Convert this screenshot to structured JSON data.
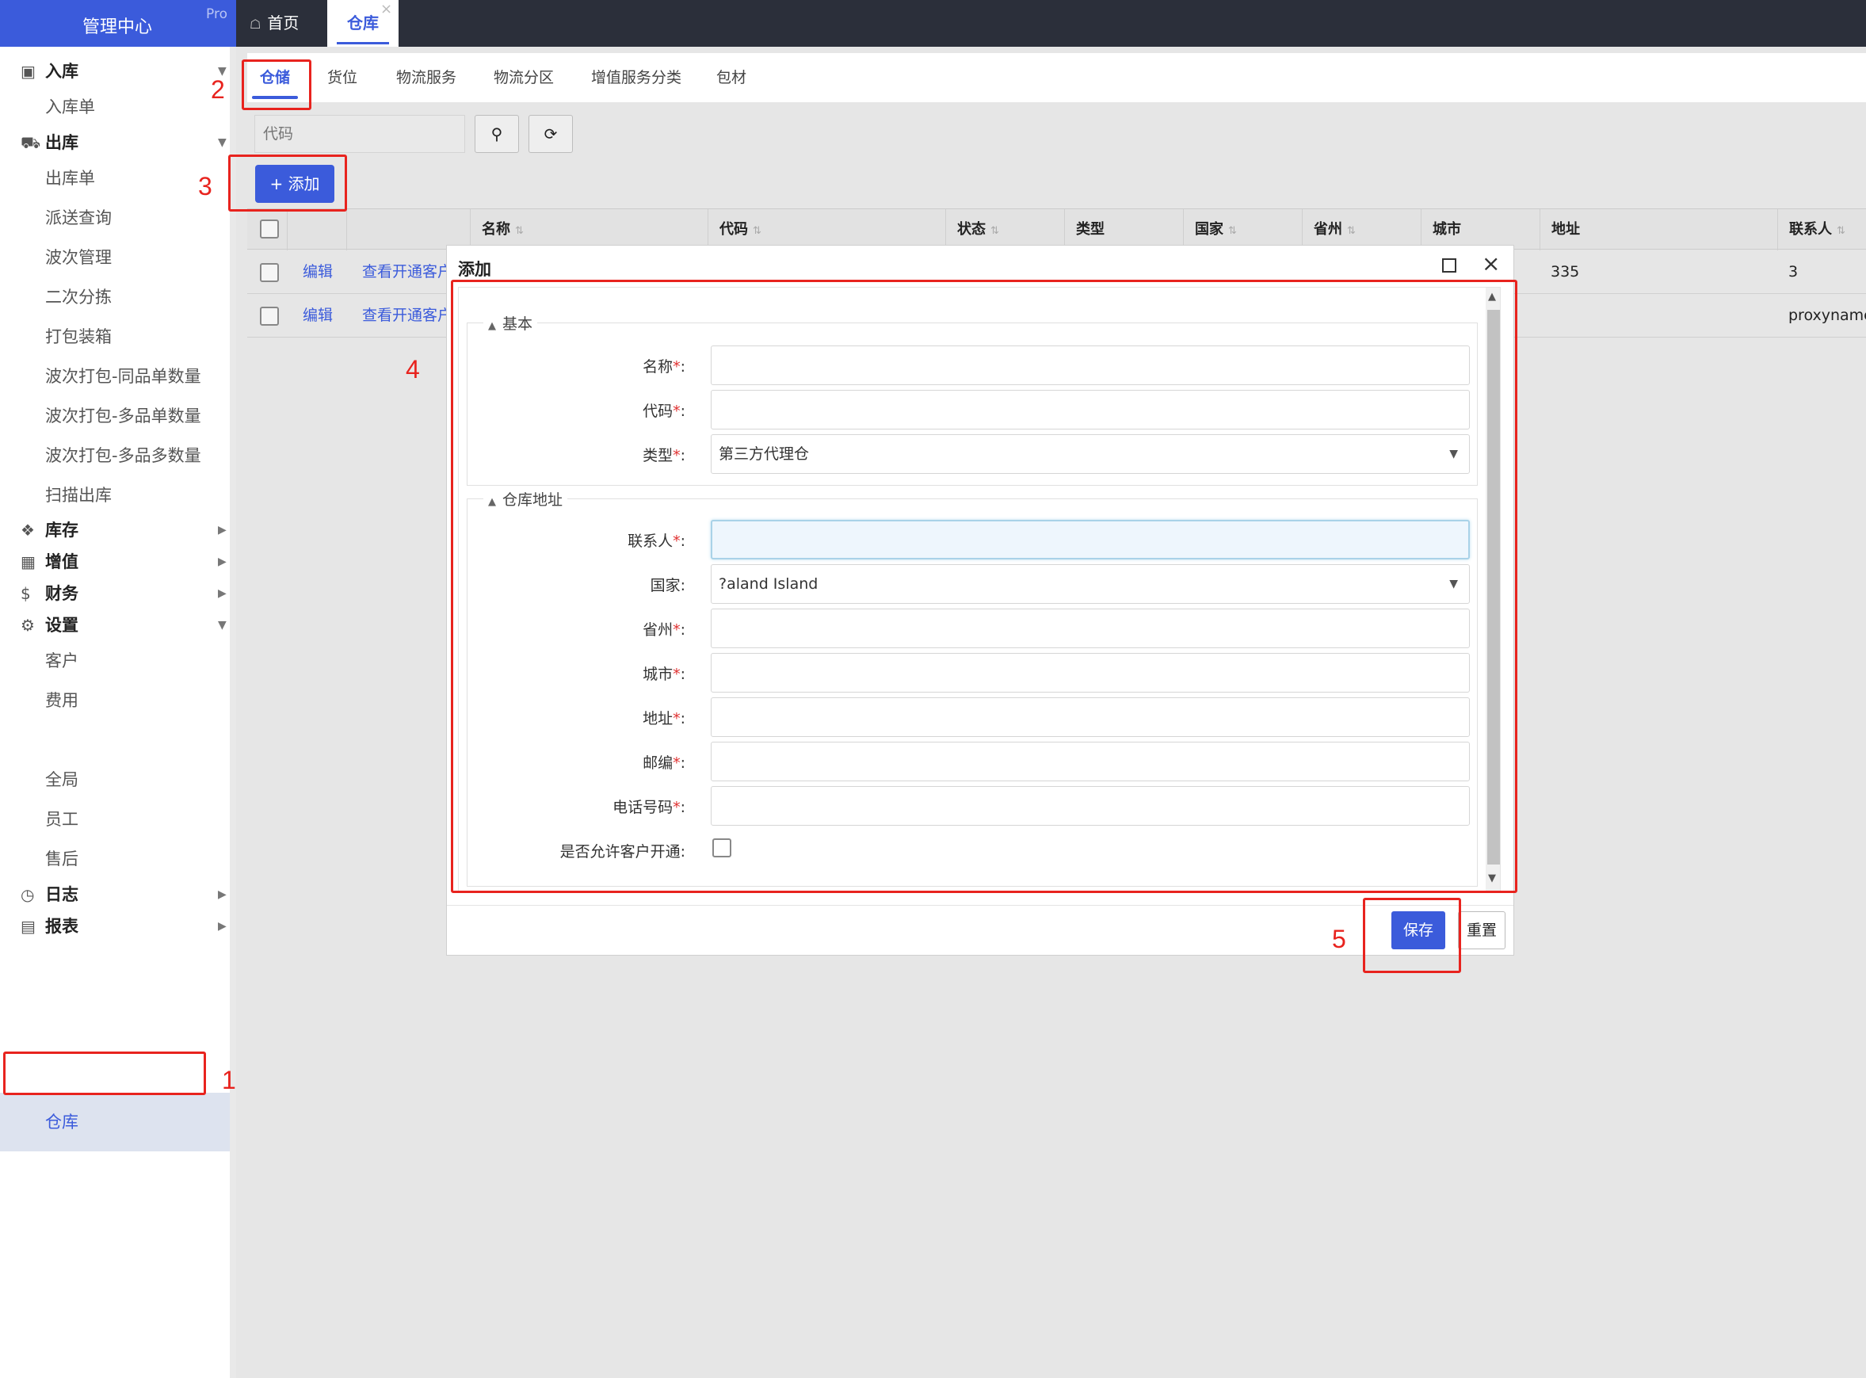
{
  "header": {
    "brand": "管理中心",
    "brand_badge": "Pro",
    "tabs": [
      {
        "label": "首页",
        "icon": "home-icon"
      },
      {
        "label": "仓库",
        "icon": "",
        "active": true
      }
    ],
    "close_glyph": "×"
  },
  "sidebar": {
    "groups": [
      {
        "label": "入库",
        "icon": "inbox-icon",
        "expanded": true,
        "items": [
          "入库单"
        ]
      },
      {
        "label": "出库",
        "icon": "truck-icon",
        "expanded": true,
        "items": [
          "出库单",
          "派送查询",
          "波次管理",
          "二次分拣",
          "打包装箱",
          "波次打包-同品单数量",
          "波次打包-多品单数量",
          "波次打包-多品多数量",
          "扫描出库"
        ]
      },
      {
        "label": "库存",
        "icon": "cubes-icon",
        "expanded": false
      },
      {
        "label": "增值",
        "icon": "grid-icon",
        "expanded": false
      },
      {
        "label": "财务",
        "icon": "dollar-icon",
        "expanded": false
      },
      {
        "label": "设置",
        "icon": "gears-icon",
        "expanded": true,
        "items": [
          "客户",
          "费用",
          "仓库",
          "全局",
          "员工",
          "售后"
        ],
        "selected": "仓库"
      },
      {
        "label": "日志",
        "icon": "clock-icon",
        "expanded": false
      },
      {
        "label": "报表",
        "icon": "bar-chart-icon",
        "expanded": false
      }
    ]
  },
  "subtabs": [
    "仓储",
    "货位",
    "物流服务",
    "物流分区",
    "增值服务分类",
    "包材"
  ],
  "toolbar": {
    "search_placeholder": "代码",
    "add_label": "添加",
    "add_icon": "+"
  },
  "table": {
    "columns": [
      "名称",
      "代码",
      "状态",
      "类型",
      "国家",
      "省州",
      "城市",
      "地址",
      "联系人"
    ],
    "sortable": [
      true,
      true,
      true,
      false,
      true,
      true,
      false,
      false,
      true
    ],
    "rows": [
      {
        "edit": "编辑",
        "view": "查看开通客户",
        "address": "335",
        "contact": "3"
      },
      {
        "edit": "编辑",
        "view": "查看开通客户",
        "address": "",
        "contact": "proxyname"
      }
    ]
  },
  "modal": {
    "title": "添加",
    "section_basic": "基本",
    "section_address": "仓库地址",
    "fields_basic": [
      {
        "label": "名称",
        "required": true,
        "value": ""
      },
      {
        "label": "代码",
        "required": true,
        "value": ""
      },
      {
        "label": "类型",
        "required": true,
        "value": "第三方代理仓",
        "select": true
      }
    ],
    "fields_address": [
      {
        "label": "联系人",
        "required": true,
        "value": "",
        "focus": true
      },
      {
        "label": "国家",
        "required": false,
        "value": "?aland Island",
        "select": true
      },
      {
        "label": "省州",
        "required": true,
        "value": ""
      },
      {
        "label": "城市",
        "required": true,
        "value": ""
      },
      {
        "label": "地址",
        "required": true,
        "value": ""
      },
      {
        "label": "邮编",
        "required": true,
        "value": ""
      },
      {
        "label": "电话号码",
        "required": true,
        "value": ""
      }
    ],
    "allow_label": "是否允许客户开通",
    "allow_checked": false,
    "save": "保存",
    "reset": "重置"
  },
  "annotations": [
    "1",
    "2",
    "3",
    "4",
    "5"
  ],
  "colors": {
    "accent": "#3b5bdb",
    "header": "#2b2f3a",
    "annotation": "#e8231e",
    "required": "#e03131"
  }
}
